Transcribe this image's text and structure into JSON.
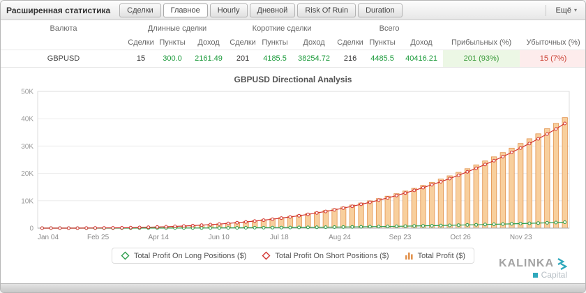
{
  "window": {
    "title": "Расширенная статистика",
    "more_label": "Ещё"
  },
  "tabs": [
    {
      "label": "Сделки",
      "active": false
    },
    {
      "label": "Главное",
      "active": true
    },
    {
      "label": "Hourly",
      "active": false
    },
    {
      "label": "Дневной",
      "active": false
    },
    {
      "label": "Risk Of Ruin",
      "active": false
    },
    {
      "label": "Duration",
      "active": false
    }
  ],
  "table": {
    "group_headers": {
      "currency": "Валюта",
      "long": "Длинные сделки",
      "short": "Короткие сделки",
      "total": "Всего"
    },
    "sub_headers": {
      "deals": "Сделки",
      "points": "Пункты",
      "income": "Доход",
      "profitable": "Прибыльных (%)",
      "losing": "Убыточных (%)"
    },
    "row": {
      "currency": "GBPUSD",
      "long": {
        "deals": "15",
        "points": "300.0",
        "income": "2161.49"
      },
      "short": {
        "deals": "201",
        "points": "4185.5",
        "income": "38254.72"
      },
      "total": {
        "deals": "216",
        "points": "4485.5",
        "income": "40416.21"
      },
      "profitable": "201 (93%)",
      "losing": "15 (7%)"
    }
  },
  "chart_data": {
    "type": "bar",
    "title": "GBPUSD Directional Analysis",
    "x_tick_labels": [
      "Jan 04",
      "Feb 25",
      "Apr 14",
      "Jun 10",
      "Jul 18",
      "Aug 24",
      "Sep 23",
      "Oct 26",
      "Nov 23"
    ],
    "y_tick_labels": [
      "0",
      "10K",
      "20K",
      "30K",
      "40K",
      "50K"
    ],
    "ylim": [
      0,
      50000
    ],
    "legend_position": "bottom",
    "series": [
      {
        "name": "Total Profit On Long Positions ($)",
        "type": "line",
        "color": "#2d9e4c",
        "values": [
          0,
          0,
          0,
          0,
          1,
          1,
          2,
          4,
          5,
          8,
          11,
          14,
          18,
          23,
          29,
          36,
          43,
          52,
          61,
          72,
          84,
          97,
          112,
          128,
          146,
          165,
          185,
          207,
          231,
          257,
          284,
          314,
          345,
          378,
          414,
          451,
          491,
          533,
          578,
          624,
          674,
          725,
          780,
          837,
          896,
          959,
          1024,
          1092,
          1163,
          1237,
          1315,
          1395,
          1478,
          1565,
          1655,
          1749,
          1845,
          1946,
          2049,
          2161
        ]
      },
      {
        "name": "Total Profit On Short Positions ($)",
        "type": "line",
        "color": "#d23430",
        "values": [
          0,
          0,
          2,
          5,
          12,
          24,
          41,
          64,
          96,
          135,
          186,
          248,
          322,
          409,
          511,
          628,
          763,
          915,
          1087,
          1278,
          1490,
          1725,
          1983,
          2266,
          2574,
          2910,
          3274,
          3666,
          4089,
          4542,
          5029,
          5549,
          6103,
          6694,
          7321,
          7986,
          8690,
          9435,
          10219,
          11048,
          11919,
          12835,
          13796,
          14804,
          15861,
          16965,
          18120,
          19325,
          20583,
          21894,
          23258,
          24679,
          26156,
          27690,
          29282,
          30934,
          32647,
          34421,
          36259,
          38255
        ]
      },
      {
        "name": "Total Profit ($)",
        "type": "bar",
        "color": "#e2924e",
        "fill": "#f8cf9d",
        "values": [
          0,
          0,
          2,
          5,
          13,
          25,
          43,
          68,
          101,
          143,
          197,
          262,
          340,
          432,
          540,
          664,
          806,
          967,
          1148,
          1350,
          1574,
          1822,
          2095,
          2394,
          2720,
          3075,
          3459,
          3873,
          4320,
          4799,
          5313,
          5863,
          6448,
          7072,
          7735,
          8437,
          9181,
          9968,
          10797,
          11672,
          12593,
          13560,
          14576,
          15641,
          16757,
          17924,
          19144,
          20417,
          21746,
          23131,
          24573,
          26074,
          27634,
          29255,
          30937,
          32683,
          34492,
          36367,
          38308,
          40416
        ]
      }
    ]
  },
  "watermark": {
    "brand": "KALINKA",
    "sub": "Capital"
  }
}
